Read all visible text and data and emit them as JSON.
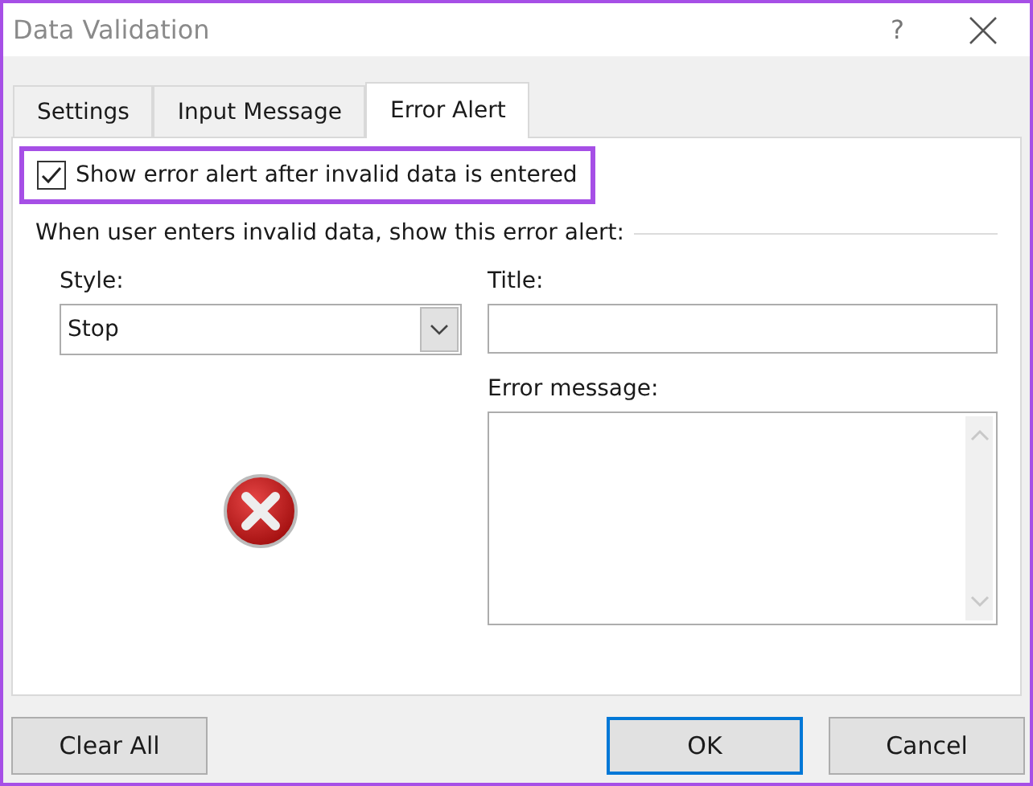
{
  "window": {
    "title": "Data Validation",
    "help": "?"
  },
  "tabs": [
    {
      "label": "Settings",
      "selected": false
    },
    {
      "label": "Input Message",
      "selected": false
    },
    {
      "label": "Error Alert",
      "selected": true
    }
  ],
  "show_alert": {
    "label": "Show error alert after invalid data is entered",
    "checked": true,
    "highlighted": true
  },
  "group_label": "When user enters invalid data, show this error alert:",
  "style": {
    "label": "Style:",
    "value": "Stop"
  },
  "title_field": {
    "label": "Title:"
  },
  "message_field": {
    "label": "Error message:"
  },
  "buttons": [
    {
      "label": "Clear All",
      "default": false
    },
    {
      "label": "OK",
      "default": true
    },
    {
      "label": "Cancel",
      "default": false
    }
  ]
}
